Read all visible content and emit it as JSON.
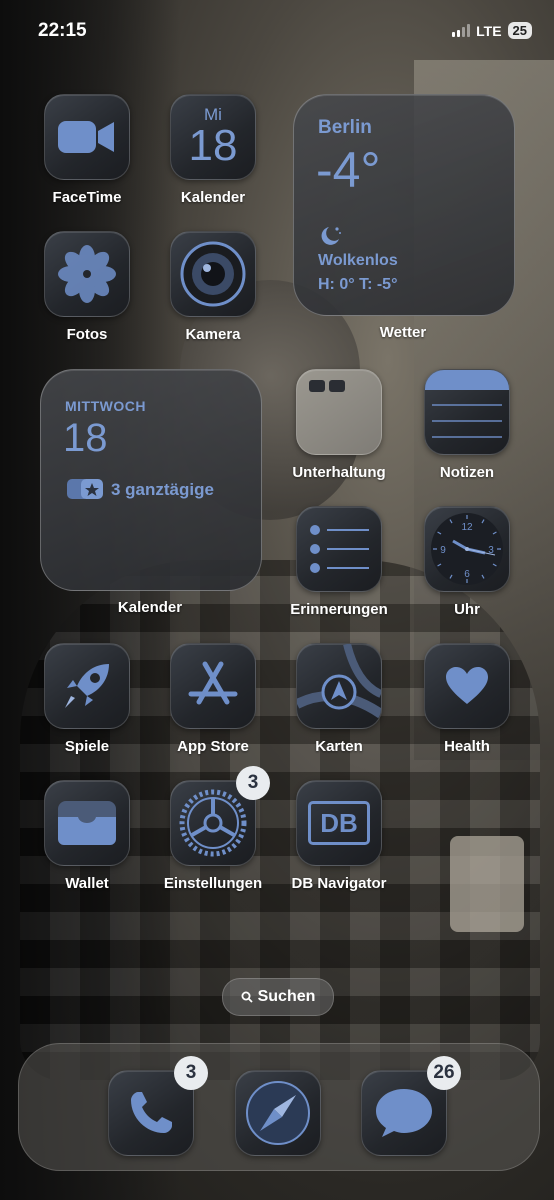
{
  "status": {
    "time": "22:15",
    "network": "LTE",
    "battery": "25"
  },
  "apps": {
    "facetime": {
      "label": "FaceTime",
      "icon": "video-camera-icon"
    },
    "kalender": {
      "label": "Kalender",
      "day": "Mi",
      "date": "18",
      "icon": "calendar-icon"
    },
    "fotos": {
      "label": "Fotos",
      "icon": "flower-icon"
    },
    "kamera": {
      "label": "Kamera",
      "icon": "camera-lens-icon"
    },
    "unterhaltung": {
      "label": "Unterhaltung",
      "icon": "folder-icon"
    },
    "notizen": {
      "label": "Notizen",
      "icon": "notes-icon"
    },
    "erinnerungen": {
      "label": "Erinnerungen",
      "icon": "list-icon"
    },
    "uhr": {
      "label": "Uhr",
      "icon": "clock-icon",
      "dial": [
        "12",
        "3",
        "6",
        "9"
      ]
    },
    "spiele": {
      "label": "Spiele",
      "icon": "rocket-icon"
    },
    "appstore": {
      "label": "App Store",
      "icon": "app-store-icon"
    },
    "karten": {
      "label": "Karten",
      "icon": "map-icon"
    },
    "health": {
      "label": "Health",
      "icon": "heart-icon"
    },
    "wallet": {
      "label": "Wallet",
      "icon": "wallet-icon"
    },
    "einstellungen": {
      "label": "Einstellungen",
      "icon": "gear-icon",
      "badge": "3"
    },
    "db": {
      "label": "DB Navigator",
      "text": "DB",
      "icon": "db-logo-icon"
    }
  },
  "weather": {
    "city": "Berlin",
    "temp": "-4°",
    "condition": "Wolkenlos",
    "hilo": "H: 0° T: -5°",
    "caption": "Wetter",
    "icon": "moon-stars-icon"
  },
  "calendar_widget": {
    "weekday": "MITTWOCH",
    "date": "18",
    "events": "3 ganztägige",
    "caption": "Kalender",
    "icon": "calendar-events-icon"
  },
  "search": {
    "label": "Suchen",
    "icon": "search-icon"
  },
  "dock": {
    "phone": {
      "badge": "3",
      "icon": "phone-icon"
    },
    "safari": {
      "icon": "compass-icon"
    },
    "messages": {
      "badge": "26",
      "icon": "speech-bubble-icon"
    }
  },
  "colors": {
    "accent": "#7b9ad1",
    "tile_dark": "#23262b",
    "badge_bg": "#e9ecef"
  }
}
